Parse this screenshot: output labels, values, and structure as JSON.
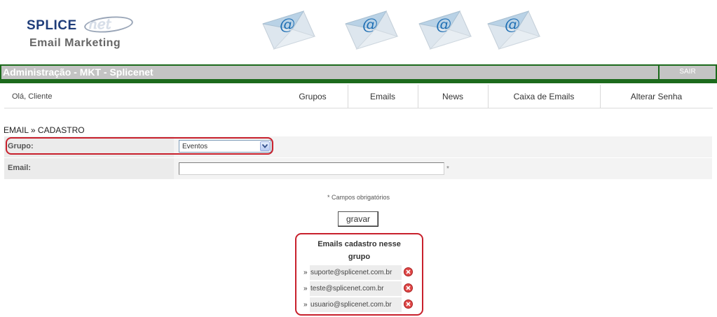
{
  "logo": {
    "brand": "SPLICE",
    "brand_suffix": "net",
    "subtitle": "Email Marketing"
  },
  "header": {
    "envelope_icon": "email-envelope-icon"
  },
  "titlebar": {
    "title": "Administração - MKT - Splicenet",
    "logout_label": "SAIR"
  },
  "nav": {
    "greeting": "Olá, Cliente",
    "items": [
      {
        "label": "Grupos"
      },
      {
        "label": "Emails"
      },
      {
        "label": "News"
      },
      {
        "label": "Caixa de Emails"
      },
      {
        "label": "Alterar Senha"
      }
    ]
  },
  "breadcrumb": "EMAIL » CADASTRO",
  "form": {
    "group_label": "Grupo:",
    "group_value": "Eventos",
    "email_label": "Email:",
    "email_value": "",
    "required_mark": "*",
    "required_note": "* Campos obrigatórios",
    "submit_label": "gravar"
  },
  "emails_list": {
    "title_line1": "Emails cadastro nesse",
    "title_line2": "grupo",
    "bullet": "»",
    "items": [
      "suporte@splicenet.com.br",
      "teste@splicenet.com.br",
      "usuario@splicenet.com.br"
    ],
    "delete_icon": "delete-icon"
  },
  "colors": {
    "accent_green": "#1c6a1c",
    "title_gray": "#c4c4c4",
    "highlight_red": "#c8202c"
  }
}
